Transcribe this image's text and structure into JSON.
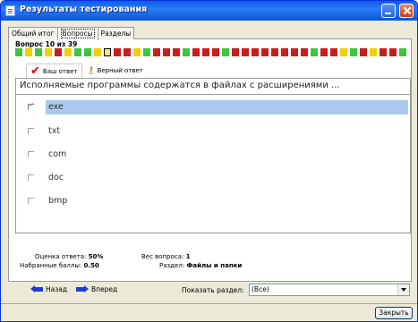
{
  "window": {
    "title": "Результаты тестирования"
  },
  "tabs": [
    {
      "label": "Общий итог",
      "active": false
    },
    {
      "label": "Вопросы",
      "active": true
    },
    {
      "label": "Разделы",
      "active": false
    }
  ],
  "question_counter": "Вопрос 10 из 39",
  "progress": {
    "colors": {
      "G": "#3fc43f",
      "R": "#c81e1e",
      "Y": "#f0d000",
      "C": "#f5e86a"
    },
    "cells": "GYGYRYGGYCRRYGRRRGRRRGRRRRRRRRGRRYGRYRRG"
  },
  "answer_tabs": {
    "your_answer": "Ваш ответ",
    "correct_answer": "Верный ответ"
  },
  "question": {
    "text": "Исполняемые программы содержатся в файлах с расширениями ...",
    "options": [
      {
        "label": "exe",
        "selected": true
      },
      {
        "label": "txt",
        "selected": false
      },
      {
        "label": "com",
        "selected": false
      },
      {
        "label": "doc",
        "selected": false
      },
      {
        "label": "bmp",
        "selected": false
      }
    ]
  },
  "stats": {
    "score_label": "Оценка ответа:",
    "score_value": "50%",
    "points_label": "Набранные баллы:",
    "points_value": "0.50",
    "weight_label": "Вес вопроса:",
    "weight_value": "1",
    "section_label": "Раздел:",
    "section_value": "Файлы и папки"
  },
  "nav": {
    "back": "Назад",
    "forward": "Вперед",
    "show_section": "Показать раздел:",
    "section_select": "(Все)"
  },
  "footer": {
    "close": "Закрыть"
  }
}
